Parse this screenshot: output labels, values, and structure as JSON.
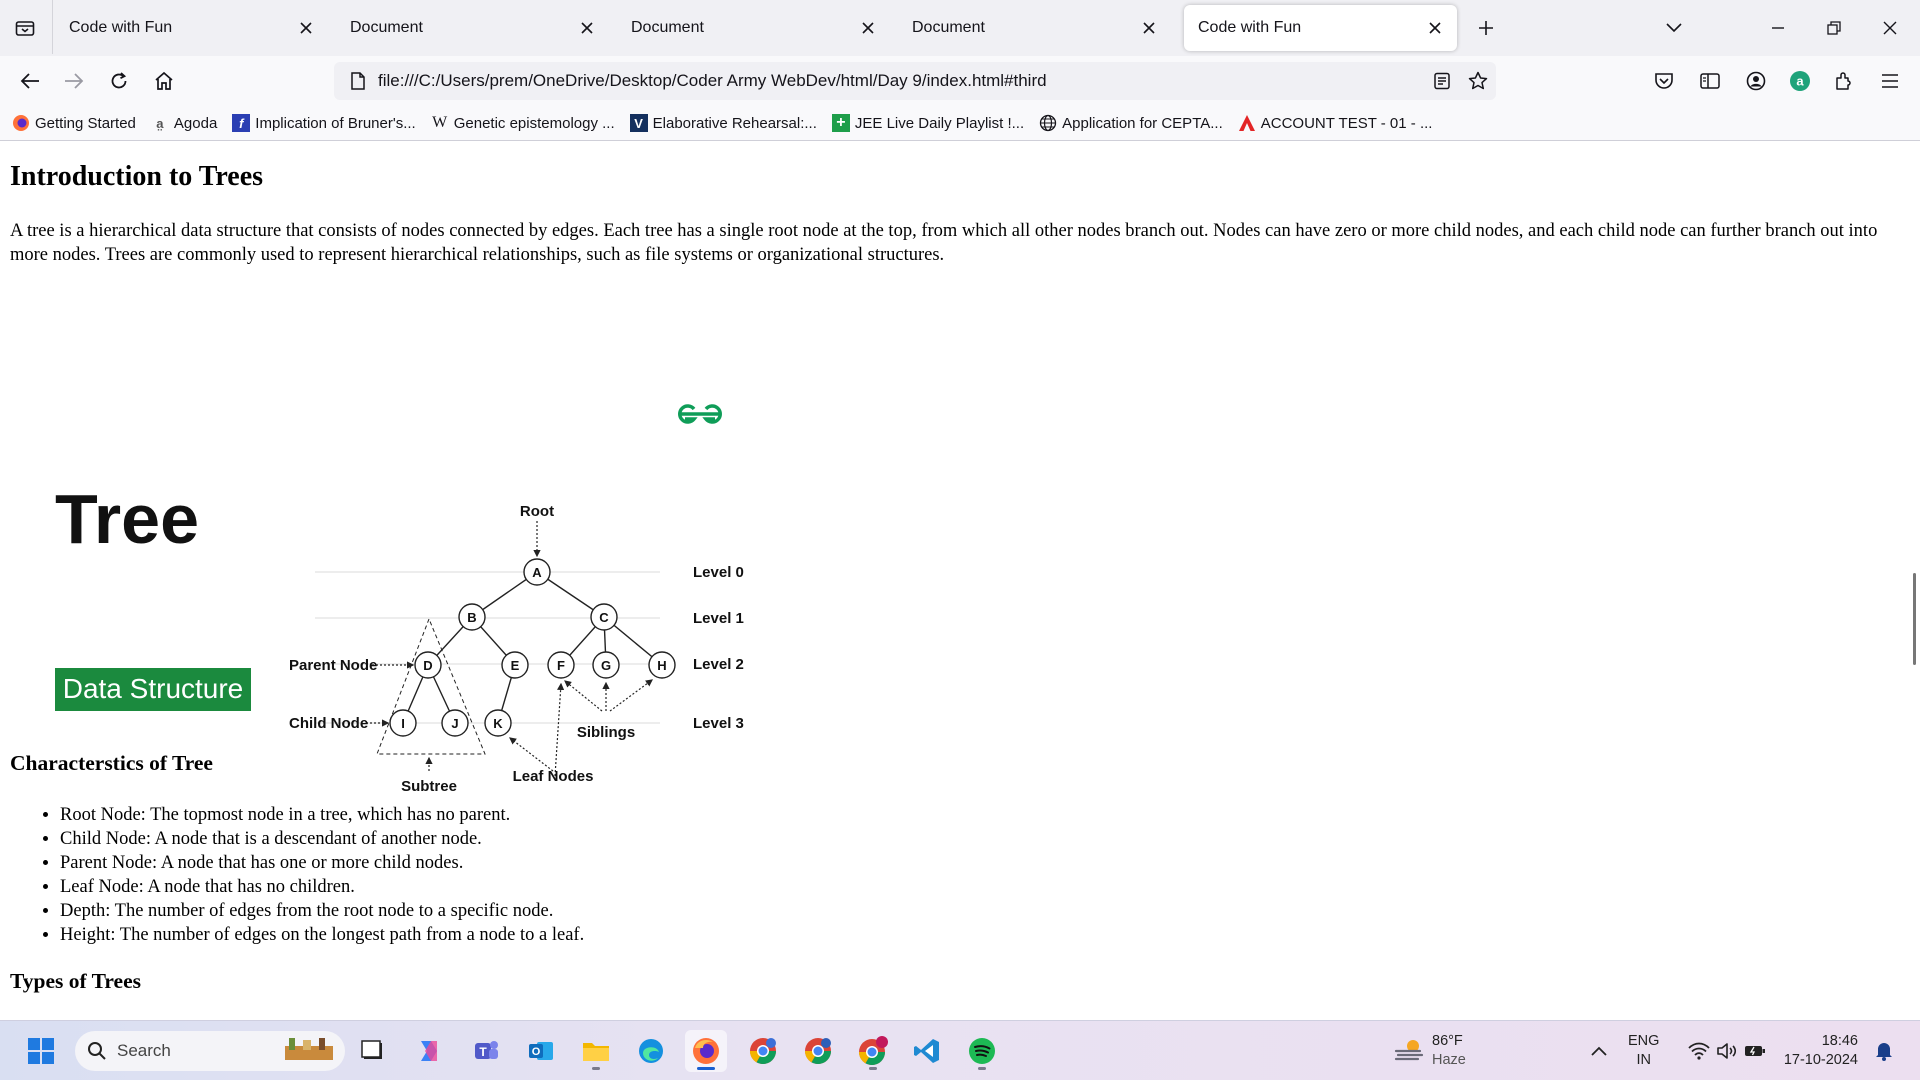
{
  "tabs": [
    {
      "title": "Code with Fun",
      "active": false
    },
    {
      "title": "Document",
      "active": false
    },
    {
      "title": "Document",
      "active": false
    },
    {
      "title": "Document",
      "active": false
    },
    {
      "title": "Code with Fun",
      "active": true
    }
  ],
  "url": "file:///C:/Users/prem/OneDrive/Desktop/Coder Army WebDev/html/Day 9/index.html#third",
  "bookmarks": [
    {
      "label": "Getting Started",
      "icon": "firefox-icon"
    },
    {
      "label": "Agoda",
      "icon": "agoda-icon"
    },
    {
      "label": "Implication of Bruner's...",
      "icon": "f-icon"
    },
    {
      "label": "Genetic epistemology ...",
      "icon": "wikipedia-icon"
    },
    {
      "label": "Elaborative Rehearsal:...",
      "icon": "v-icon"
    },
    {
      "label": "JEE Live Daily Playlist !...",
      "icon": "plus-icon"
    },
    {
      "label": "Application for CEPTA...",
      "icon": "globe-icon"
    },
    {
      "label": "ACCOUNT TEST - 01 - ...",
      "icon": "a-logo-icon"
    }
  ],
  "page": {
    "heading": "Introduction to Trees",
    "intro": "A tree is a hierarchical data structure that consists of nodes connected by edges. Each tree has a single root node at the top, from which all other nodes branch out. Nodes can have zero or more child nodes, and each child node can further branch out into more nodes. Trees are commonly used to represent hierarchical relationships, such as file systems or organizational structures.",
    "characteristics_heading": "Characterstics of Tree",
    "characteristics": [
      "Root Node: The topmost node in a tree, which has no parent.",
      "Child Node: A node that is a descendant of another node.",
      "Parent Node: A node that has one or more child nodes.",
      "Leaf Node: A node that has no children.",
      "Depth: The number of edges from the root node to a specific node.",
      "Height: The number of edges on the longest path from a node to a leaf."
    ],
    "types_heading": "Types of Trees"
  },
  "figure": {
    "title_big": "Tree",
    "title_badge": "Data Structure",
    "brand_logo": "geeksforgeeks-logo",
    "labels": {
      "root": "Root",
      "parent": "Parent Node",
      "child": "Child Node",
      "subtree": "Subtree",
      "leaf": "Leaf Nodes",
      "siblings": "Siblings",
      "level0": "Level 0",
      "level1": "Level 1",
      "level2": "Level 2",
      "level3": "Level 3"
    },
    "nodes": [
      "A",
      "B",
      "C",
      "D",
      "E",
      "F",
      "G",
      "H",
      "I",
      "J",
      "K"
    ],
    "accent": "#0f9d58"
  },
  "taskbar": {
    "search_placeholder": "Search",
    "weather_temp": "86°F",
    "weather_desc": "Haze",
    "lang_1": "ENG",
    "lang_2": "IN",
    "time": "18:46",
    "date": "17-10-2024"
  }
}
